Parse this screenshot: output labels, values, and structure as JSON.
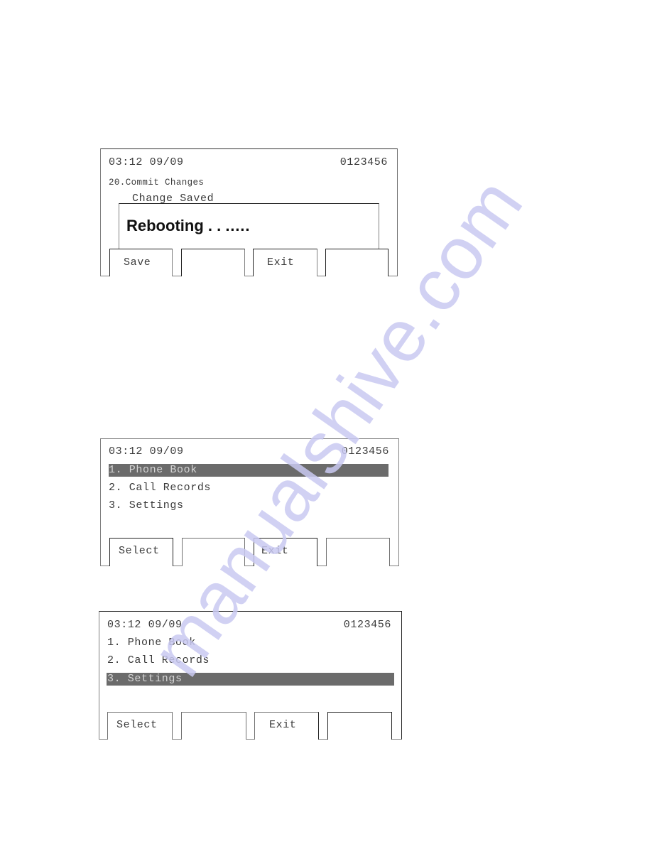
{
  "screens": [
    {
      "id": "commit-changes",
      "time_date": "03:12 09/09",
      "number": "0123456",
      "menu_title": "20.Commit Changes",
      "status_text": "Change Saved",
      "popup_message": "Rebooting . . .….",
      "softkeys": [
        "Save",
        "",
        "Exit",
        ""
      ]
    },
    {
      "id": "main-menu-phonebook",
      "time_date": "03:12 09/09",
      "number": "0123456",
      "menu_items": [
        "1. Phone Book",
        "2. Call Records",
        "3. Settings"
      ],
      "selected_index": 0,
      "softkeys": [
        "Select",
        "",
        "Exit",
        ""
      ]
    },
    {
      "id": "main-menu-settings",
      "time_date": "03:12 09/09",
      "number": "0123456",
      "menu_items": [
        "1. Phone Book",
        "2. Call Records",
        "3. Settings"
      ],
      "selected_index": 2,
      "softkeys": [
        "Select",
        "",
        "Exit",
        ""
      ]
    }
  ],
  "colors": {
    "highlight_bg": "#6b6b6b",
    "highlight_text": "#d6d6d6",
    "watermark": "#c9c9f2"
  },
  "watermark_text": "manualshive.com"
}
